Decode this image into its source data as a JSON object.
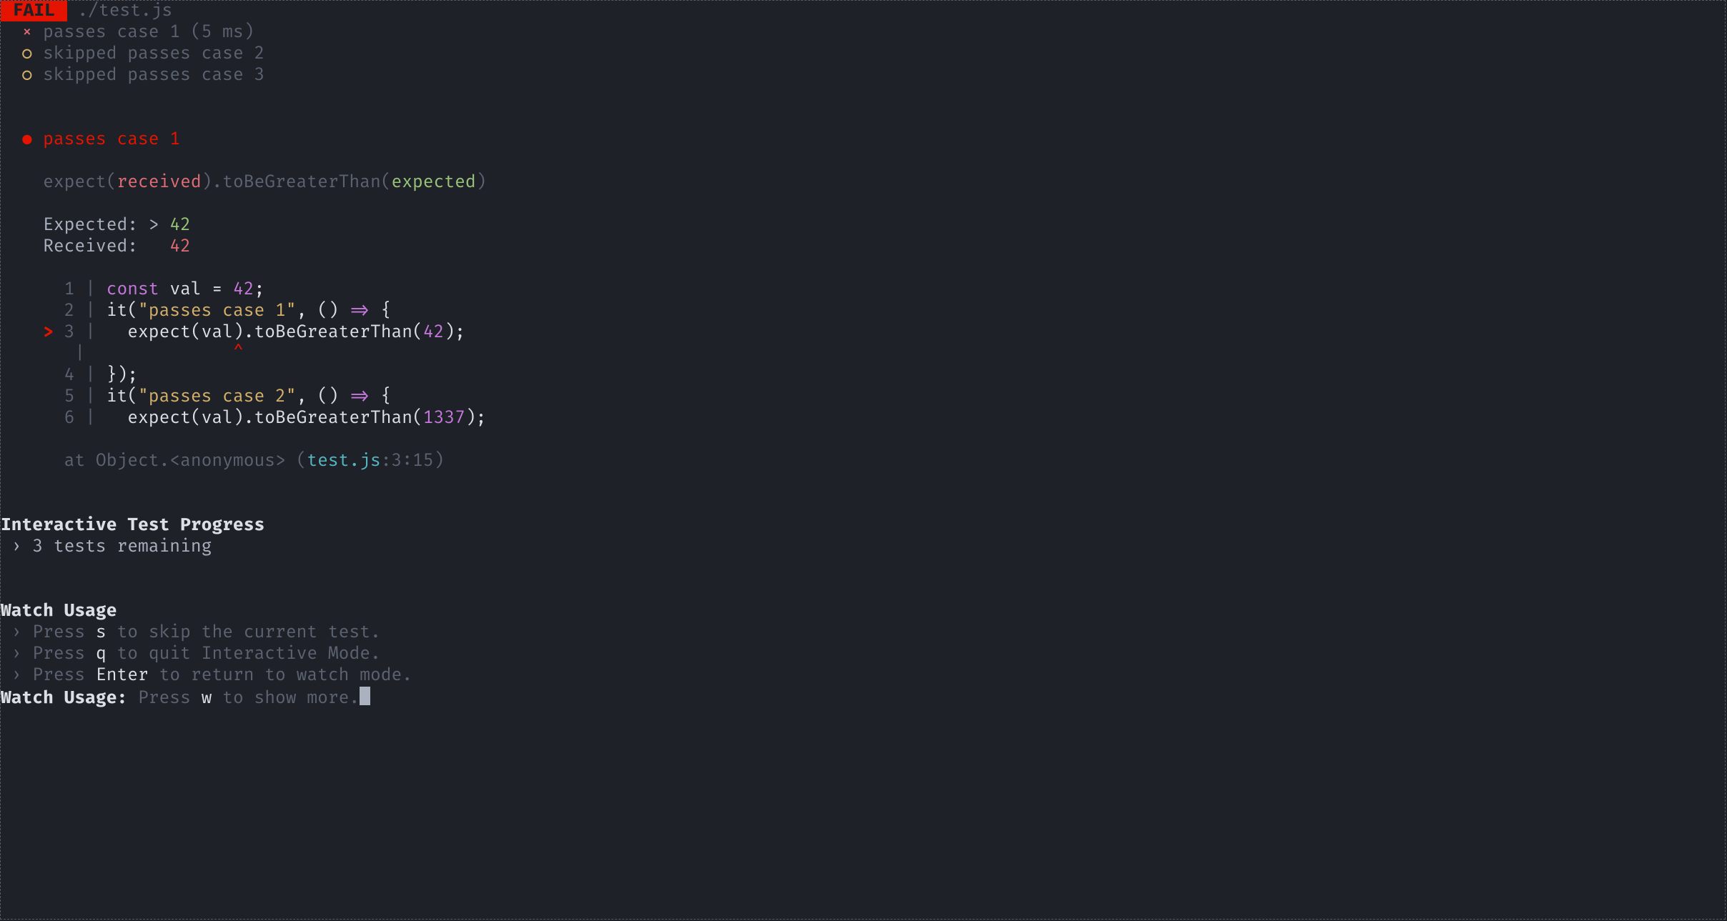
{
  "header": {
    "fail_badge": " FAIL ",
    "file_path": "./test.js"
  },
  "test_results": [
    {
      "marker": "×",
      "label": "passes case 1",
      "duration": "(5 ms)",
      "status": "failed"
    },
    {
      "marker": "○",
      "label": "skipped passes case 2",
      "duration": "",
      "status": "skipped"
    },
    {
      "marker": "○",
      "label": "skipped passes case 3",
      "duration": "",
      "status": "skipped"
    }
  ],
  "failure": {
    "bullet": "●",
    "title": "passes case 1",
    "assertion_prefix": "expect(",
    "assertion_received": "received",
    "assertion_mid": ").",
    "assertion_matcher": "toBeGreaterThan",
    "assertion_open": "(",
    "assertion_expected": "expected",
    "assertion_close": ")",
    "expected_label": "Expected:",
    "expected_op": " > ",
    "expected_value": "42",
    "received_label": "Received:",
    "received_pad": "   ",
    "received_value": "42",
    "stack_prefix": "at Object.<anonymous> (",
    "stack_file": "test.js",
    "stack_suffix": ":3:15)"
  },
  "code": {
    "lines": [
      {
        "ptr": " ",
        "num": "1",
        "tokens": [
          {
            "t": "const ",
            "c": "purple"
          },
          {
            "t": "val = ",
            "c": "white"
          },
          {
            "t": "42",
            "c": "purple"
          },
          {
            "t": ";",
            "c": "white"
          }
        ]
      },
      {
        "ptr": " ",
        "num": "2",
        "tokens": [
          {
            "t": "it(",
            "c": "white"
          },
          {
            "t": "\"passes case 1\"",
            "c": "yellow"
          },
          {
            "t": ", () ",
            "c": "white"
          },
          {
            "t": "=>",
            "c": "purple"
          },
          {
            "t": " {",
            "c": "white"
          }
        ]
      },
      {
        "ptr": ">",
        "num": "3",
        "tokens": [
          {
            "t": "  expect(val).toBeGreaterThan(",
            "c": "white"
          },
          {
            "t": "42",
            "c": "purple"
          },
          {
            "t": ");",
            "c": "white"
          }
        ]
      },
      {
        "ptr": "caret",
        "num": " ",
        "tokens": [
          {
            "t": "             ",
            "c": "white"
          },
          {
            "t": "^",
            "c": "hard-red"
          }
        ]
      },
      {
        "ptr": " ",
        "num": "4",
        "tokens": [
          {
            "t": "});",
            "c": "white"
          }
        ]
      },
      {
        "ptr": " ",
        "num": "5",
        "tokens": [
          {
            "t": "it(",
            "c": "white"
          },
          {
            "t": "\"passes case 2\"",
            "c": "yellow"
          },
          {
            "t": ", () ",
            "c": "white"
          },
          {
            "t": "=>",
            "c": "purple"
          },
          {
            "t": " {",
            "c": "white"
          }
        ]
      },
      {
        "ptr": " ",
        "num": "6",
        "tokens": [
          {
            "t": "  expect(val).toBeGreaterThan(",
            "c": "white"
          },
          {
            "t": "1337",
            "c": "purple"
          },
          {
            "t": ");",
            "c": "white"
          }
        ]
      }
    ]
  },
  "progress": {
    "title": "Interactive Test Progress",
    "line": "3 tests remaining"
  },
  "watch": {
    "title": "Watch Usage",
    "items": [
      {
        "press": "Press ",
        "key": "s",
        "rest": " to skip the current test."
      },
      {
        "press": "Press ",
        "key": "q",
        "rest": " to quit Interactive Mode."
      },
      {
        "press": "Press ",
        "key": "Enter",
        "rest": " to return to watch mode."
      }
    ],
    "footer_label": "Watch Usage:",
    "footer_press": " Press ",
    "footer_key": "w",
    "footer_rest": " to show more."
  }
}
